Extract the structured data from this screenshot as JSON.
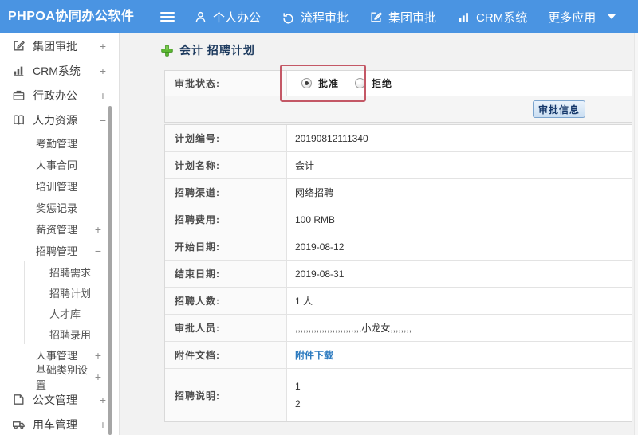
{
  "topbar": {
    "logo": "PHPOA协同办公软件",
    "items": [
      {
        "label": "个人办公",
        "icon": "user-icon"
      },
      {
        "label": "流程审批",
        "icon": "workflow-icon"
      },
      {
        "label": "集团审批",
        "icon": "edit-icon"
      },
      {
        "label": "CRM系统",
        "icon": "bar-chart-icon"
      },
      {
        "label": "更多应用",
        "icon": "caret-down-icon"
      }
    ]
  },
  "sidebar": {
    "items": [
      {
        "label": "集团审批",
        "icon": "edit-square-icon",
        "expander": "+"
      },
      {
        "label": "CRM系统",
        "icon": "bar-chart-icon",
        "expander": "+"
      },
      {
        "label": "行政办公",
        "icon": "briefcase-icon",
        "expander": "+"
      },
      {
        "label": "人力资源",
        "icon": "book-icon",
        "expander": "−"
      },
      {
        "label": "考勤管理"
      },
      {
        "label": "人事合同"
      },
      {
        "label": "培训管理"
      },
      {
        "label": "奖惩记录"
      },
      {
        "label": "薪资管理",
        "expander": "+"
      },
      {
        "label": "招聘管理",
        "expander": "−"
      },
      {
        "label": "招聘需求"
      },
      {
        "label": "招聘计划"
      },
      {
        "label": "人才库"
      },
      {
        "label": "招聘录用"
      },
      {
        "label": "人事管理",
        "expander": "+"
      },
      {
        "label": "基础类别设置",
        "expander": "+"
      },
      {
        "label": "公文管理",
        "icon": "document-icon",
        "expander": "+"
      },
      {
        "label": "用车管理",
        "icon": "truck-icon",
        "expander": "+"
      }
    ]
  },
  "main": {
    "title": "会计 招聘计划",
    "approval": {
      "label": "审批状态:",
      "options": [
        {
          "label": "批准",
          "selected": true
        },
        {
          "label": "拒绝",
          "selected": false
        }
      ],
      "button_label": "审批信息"
    },
    "rows": [
      {
        "label": "计划编号:",
        "value": "20190812111340"
      },
      {
        "label": "计划名称:",
        "value": "会计"
      },
      {
        "label": "招聘渠道:",
        "value": "网络招聘"
      },
      {
        "label": "招聘费用:",
        "value": "100 RMB"
      },
      {
        "label": "开始日期:",
        "value": "2019-08-12"
      },
      {
        "label": "结束日期:",
        "value": "2019-08-31"
      },
      {
        "label": "招聘人数:",
        "value": "1 人"
      },
      {
        "label": "审批人员:",
        "value": ",,,,,,,,,,,,,,,,,,,,,,,,,小龙女,,,,,,,,"
      },
      {
        "label": "附件文档:",
        "value": "附件下载"
      },
      {
        "label": "招聘说明:",
        "lines": [
          "1",
          "2"
        ]
      }
    ]
  },
  "colors": {
    "topbar": "#4a94e2",
    "highlight_box": "#c45866",
    "title": "#1d3a5e",
    "link": "#2f7cc0",
    "plus_icon_green": "#5cb832"
  }
}
